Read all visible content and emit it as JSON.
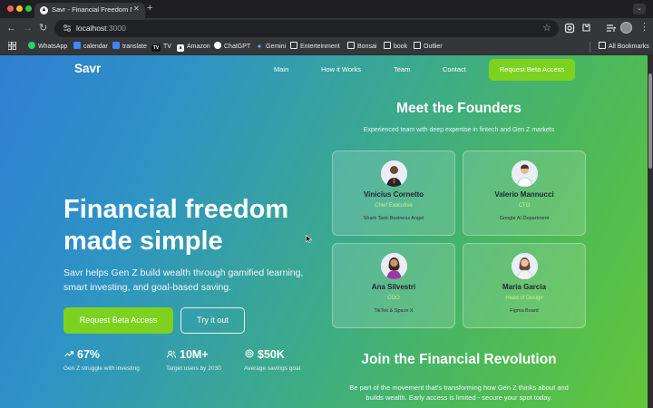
{
  "browser": {
    "tab_title": "Savr - Financial Freedom Ma",
    "url_host": "localhost",
    "url_port": ":3000",
    "bookmarks": [
      "WhatsApp",
      "calendar",
      "translate",
      "TV",
      "Amazon",
      "ChatGPT",
      "Gemini",
      "Enterteinment",
      "Bonsai",
      "book",
      "Outlier"
    ],
    "all_bookmarks": "All Bookmarks"
  },
  "nav": {
    "logo": "Savr",
    "links": [
      "Main",
      "How it Works",
      "Team",
      "Contact"
    ],
    "cta": "Request Beta Access"
  },
  "hero": {
    "title": "Financial freedom made simple",
    "subtitle": "Savr helps Gen Z build wealth through gamified learning, smart investing, and goal-based saving.",
    "primary_button": "Request Beta Access",
    "secondary_button": "Try it out"
  },
  "stats": [
    {
      "value": "67%",
      "label": "Gen Z struggle with investing",
      "icon": "trend-up-icon"
    },
    {
      "value": "10M+",
      "label": "Target users by 2030",
      "icon": "users-icon"
    },
    {
      "value": "$50K",
      "label": "Average savings goal",
      "icon": "target-icon"
    }
  ],
  "founders": {
    "title": "Meet the Founders",
    "subtitle": "Experienced team with deep expertise in fintech and Gen Z markets",
    "people": [
      {
        "name": "Vinicius Cornetto",
        "role": "Chief Executive",
        "company": "Shark Tank Business Angel"
      },
      {
        "name": "Valerio Mannucci",
        "role": "CTO",
        "company": "Google AI Department"
      },
      {
        "name": "Ana Silvestri",
        "role": "COO",
        "company": "TikTok & Space X"
      },
      {
        "name": "Maria Garcia",
        "role": "Head of Design",
        "company": "Figma Board"
      }
    ]
  },
  "join": {
    "title": "Join the Financial Revolution",
    "text": "Be part of the movement that's transforming how Gen Z thinks about and builds wealth. Early access is limited - secure your spot today."
  },
  "colors": {
    "accent_green": "#7dd21f",
    "gradient_start": "#2f7fd3",
    "gradient_end": "#62c63a"
  }
}
